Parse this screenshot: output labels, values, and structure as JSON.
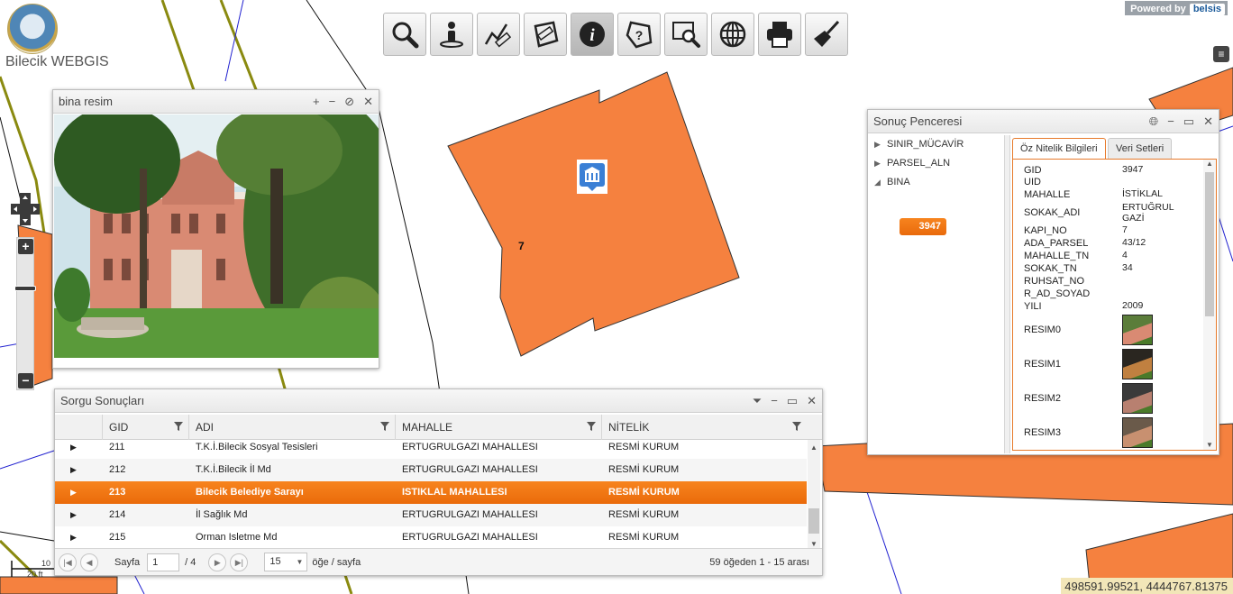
{
  "app": {
    "title": "Bilecik WEBGIS",
    "powered_by": "Powered by",
    "powered_brand": "belsis"
  },
  "toolbar": [
    {
      "name": "search-tool",
      "icon": "magnifier-icon",
      "active": false
    },
    {
      "name": "person-tool",
      "icon": "person-icon",
      "active": false
    },
    {
      "name": "measure-line-tool",
      "icon": "measure-line-icon",
      "active": false
    },
    {
      "name": "measure-area-tool",
      "icon": "measure-area-icon",
      "active": false
    },
    {
      "name": "info-tool",
      "icon": "info-icon",
      "active": true
    },
    {
      "name": "query-tool",
      "icon": "polygon-question-icon",
      "active": false
    },
    {
      "name": "zoom-box-tool",
      "icon": "zoom-box-icon",
      "active": false
    },
    {
      "name": "globe-tool",
      "icon": "globe-icon",
      "active": false
    },
    {
      "name": "print-tool",
      "icon": "printer-icon",
      "active": false
    },
    {
      "name": "clear-tool",
      "icon": "broom-icon",
      "active": false
    }
  ],
  "map": {
    "parcel_label": "7",
    "scale_top": "10",
    "scale_bottom": "20 ft",
    "coordinates": "498591.99521, 4444767.81375",
    "parcel_color": "#f5813f"
  },
  "photo_window": {
    "title": "bina resim"
  },
  "grid_window": {
    "title": "Sorgu Sonuçları",
    "columns": [
      "GID",
      "ADI",
      "MAHALLE",
      "NİTELİK"
    ],
    "rows": [
      {
        "gid": "211",
        "adi": "T.K.İ.Bilecik Sosyal Tesisleri",
        "mahalle": "ERTUGRULGAZI MAHALLESI",
        "nitelik": "RESMİ KURUM",
        "selected": false
      },
      {
        "gid": "212",
        "adi": "T.K.İ.Bilecik İl Md",
        "mahalle": "ERTUGRULGAZI MAHALLESI",
        "nitelik": "RESMİ KURUM",
        "selected": false
      },
      {
        "gid": "213",
        "adi": "Bilecik Belediye Sarayı",
        "mahalle": "ISTIKLAL MAHALLESI",
        "nitelik": "RESMİ KURUM",
        "selected": true
      },
      {
        "gid": "214",
        "adi": "İl Sağlık Md",
        "mahalle": "ERTUGRULGAZI MAHALLESI",
        "nitelik": "RESMİ KURUM",
        "selected": false
      },
      {
        "gid": "215",
        "adi": "Orman Isletme Md",
        "mahalle": "ERTUGRULGAZI MAHALLESI",
        "nitelik": "RESMİ KURUM",
        "selected": false
      }
    ],
    "pager": {
      "page_label": "Sayfa",
      "page": "1",
      "total_pages": "/ 4",
      "page_size": "15",
      "per_page_label": "öğe / sayfa",
      "summary": "59 öğeden 1 - 15 arası"
    }
  },
  "result_window": {
    "title": "Sonuç Penceresi",
    "tree": [
      "SINIR_MÜCAVİR",
      "PARSEL_ALN",
      "BINA"
    ],
    "selected_feature": "3947",
    "tabs": [
      "Öz Nitelik Bilgileri",
      "Veri Setleri"
    ],
    "attributes": [
      {
        "key": "GID",
        "value": "3947"
      },
      {
        "key": "UID",
        "value": ""
      },
      {
        "key": "MAHALLE",
        "value": "İSTİKLAL"
      },
      {
        "key": "SOKAK_ADI",
        "value": "ERTUĞRUL GAZİ"
      },
      {
        "key": "KAPI_NO",
        "value": "7"
      },
      {
        "key": "ADA_PARSEL",
        "value": "43/12"
      },
      {
        "key": "MAHALLE_TN",
        "value": "4"
      },
      {
        "key": "SOKAK_TN",
        "value": "34"
      },
      {
        "key": "RUHSAT_NO",
        "value": ""
      },
      {
        "key": "R_AD_SOYAD",
        "value": ""
      },
      {
        "key": "YILI",
        "value": "2009"
      }
    ],
    "image_fields": [
      "RESIM0",
      "RESIM1",
      "RESIM2",
      "RESIM3"
    ]
  }
}
